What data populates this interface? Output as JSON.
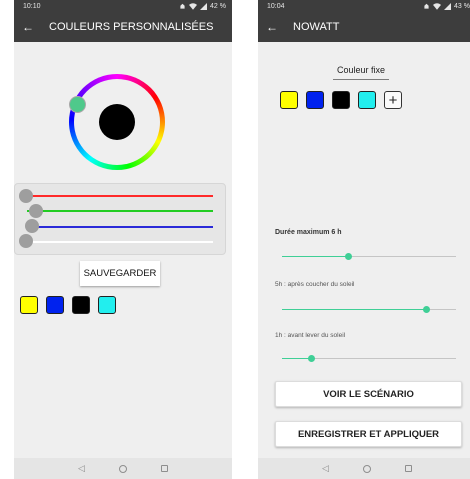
{
  "left_screen": {
    "status": {
      "time": "10:10",
      "battery": "42 %"
    },
    "appbar": {
      "title": "COULEURS PERSONNALISÉES"
    },
    "color_wheel": {
      "selected_color": "#000000",
      "thumb_color": "#4fc98b"
    },
    "rgb_sliders": [
      {
        "channel": "red",
        "color": "#ff2a2a",
        "value": 0
      },
      {
        "channel": "green",
        "color": "#22cc22",
        "value": 0
      },
      {
        "channel": "blue",
        "color": "#2a2ad8",
        "value": 0
      },
      {
        "channel": "white",
        "color": "#ffffff",
        "value": 0
      }
    ],
    "save_button": {
      "label": "SAUVEGARDER"
    },
    "swatches": [
      "#ffff00",
      "#0022ee",
      "#000000",
      "#22eeee"
    ]
  },
  "right_screen": {
    "status": {
      "time": "10:04",
      "battery": "43 %"
    },
    "appbar": {
      "title": "NOWATT"
    },
    "tab": {
      "label": "Couleur fixe"
    },
    "swatches": [
      "#ffff00",
      "#0022ee",
      "#000000",
      "#22eeee"
    ],
    "add_icon": "plus-icon",
    "max_duration": {
      "label": "Durée maximum 6 h",
      "value_fraction": 0.38
    },
    "after_sunset": {
      "label": "5h : après coucher du soleil",
      "value_fraction": 0.83
    },
    "before_sunrise": {
      "label": "1h : avant lever du soleil",
      "value_fraction": 0.17
    },
    "scenario_button": {
      "label": "VOIR LE SCÉNARIO"
    },
    "apply_button": {
      "label": "ENREGISTRER ET APPLIQUER"
    }
  },
  "accent_color": "#3fcf96"
}
